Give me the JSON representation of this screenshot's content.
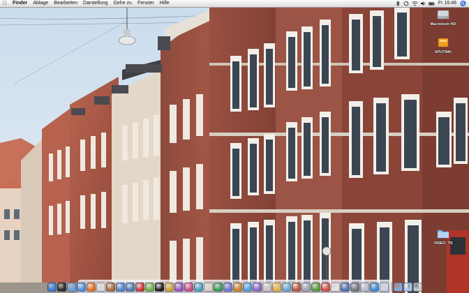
{
  "menubar": {
    "apple_icon": "apple-icon",
    "items": [
      "Finder",
      "Ablage",
      "Bearbeiten",
      "Darstellung",
      "Gehe zu",
      "Fenster",
      "Hilfe"
    ],
    "clock": "Fr 16:48"
  },
  "desktop": {
    "icons": [
      {
        "name": "macintosh-hd",
        "label": "Macintosh HD",
        "icon": "hard-drive-icon"
      },
      {
        "name": "sputnik",
        "label": "SPUTNIK",
        "icon": "drive-icon"
      },
      {
        "name": "video-ts",
        "label": "VIDEO_TS",
        "icon": "folder-icon"
      }
    ]
  },
  "dock": {
    "items": [
      {
        "icon": "finder-icon",
        "color": "#3b7bd6"
      },
      {
        "icon": "dashboard-icon",
        "color": "#2d2d2d"
      },
      {
        "icon": "mail-icon",
        "color": "#6d9fd8"
      },
      {
        "icon": "safari-icon",
        "color": "#4a8fe0"
      },
      {
        "icon": "firefox-icon",
        "color": "#e5722a"
      },
      {
        "icon": "ichat-icon",
        "color": "#d9d9d9"
      },
      {
        "icon": "addressbook-icon",
        "color": "#a86f3b"
      },
      {
        "icon": "itunes-icon",
        "color": "#5a84c9"
      },
      {
        "icon": "iphoto-icon",
        "color": "#4e7fb3"
      },
      {
        "icon": "ical-icon",
        "color": "#c93c3c"
      },
      {
        "icon": "preview-icon",
        "color": "#7ab04a"
      },
      {
        "icon": "terminal-icon",
        "color": "#222222"
      },
      {
        "icon": "app-icon",
        "color": "#d5a33a"
      },
      {
        "icon": "app-icon",
        "color": "#9a55c5"
      },
      {
        "icon": "app-icon",
        "color": "#cf4f86"
      },
      {
        "icon": "app-icon",
        "color": "#4ca3c2"
      },
      {
        "icon": "app-icon",
        "color": "#d7d4c6"
      },
      {
        "icon": "app-icon",
        "color": "#39a05a"
      },
      {
        "icon": "app-icon",
        "color": "#6f7bd4"
      },
      {
        "icon": "app-icon",
        "color": "#d2842e"
      },
      {
        "icon": "app-icon",
        "color": "#4fa6de"
      },
      {
        "icon": "app-icon",
        "color": "#8b6cc9"
      },
      {
        "icon": "app-icon",
        "color": "#c9c9c9"
      },
      {
        "icon": "app-icon",
        "color": "#e0b64b"
      },
      {
        "icon": "app-icon",
        "color": "#6aaed9"
      },
      {
        "icon": "app-icon",
        "color": "#b95a3f"
      },
      {
        "icon": "app-icon",
        "color": "#9fa8b5"
      },
      {
        "icon": "app-icon",
        "color": "#58a045"
      },
      {
        "icon": "app-icon",
        "color": "#d35050"
      },
      {
        "icon": "app-icon",
        "color": "#e6e6e6"
      },
      {
        "icon": "app-icon",
        "color": "#4d78b5"
      },
      {
        "icon": "app-icon",
        "color": "#7a7a7a"
      },
      {
        "icon": "app-icon",
        "color": "#b7bfcc"
      },
      {
        "icon": "app-icon",
        "color": "#3f8fd4"
      },
      {
        "icon": "app-icon",
        "color": "#cfd6e2"
      }
    ],
    "trailing": [
      {
        "icon": "folder-icon",
        "color": "#7eaee0"
      },
      {
        "icon": "folder-icon",
        "color": "#a9c6e8"
      },
      {
        "icon": "trash-icon",
        "color": "#c8ccd2"
      }
    ]
  }
}
